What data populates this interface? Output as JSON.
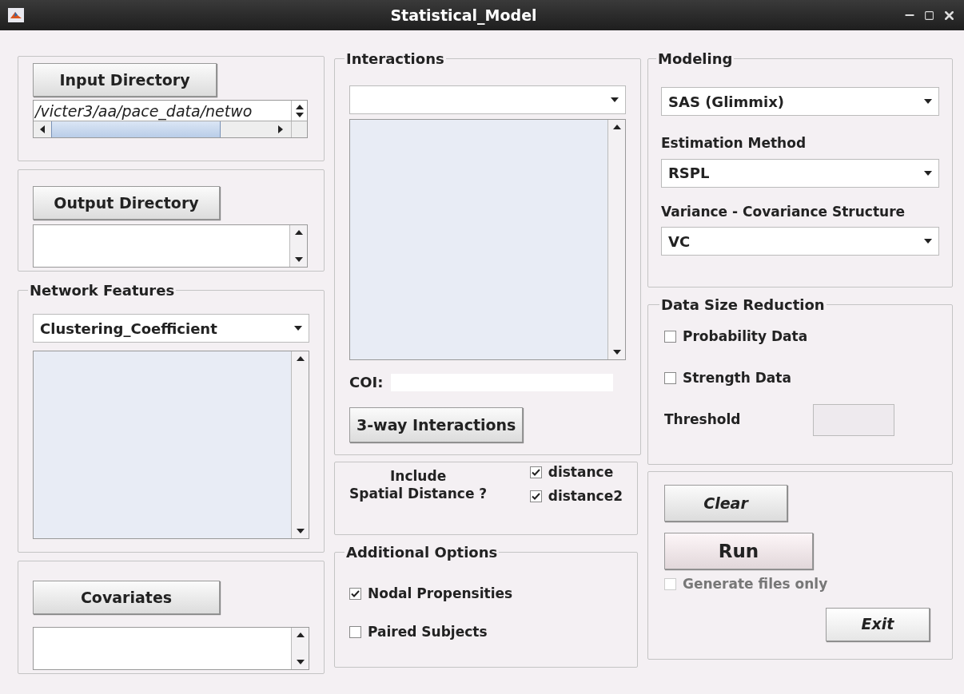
{
  "window": {
    "title": "Statistical_Model"
  },
  "input_directory": {
    "button": "Input Directory",
    "value": "/victer3/aa/pace_data/netwo"
  },
  "output_directory": {
    "button": "Output Directory"
  },
  "network_features": {
    "title": "Network Features",
    "dropdown": "Clustering_Coefficient"
  },
  "covariates": {
    "button": "Covariates"
  },
  "interactions": {
    "title": "Interactions",
    "coi_label": "COI:",
    "button": "3-way Interactions"
  },
  "spatial_distance": {
    "label_lines": [
      "Include",
      "Spatial Distance ?"
    ],
    "options": [
      {
        "label": "distance",
        "checked": true
      },
      {
        "label": "distance2",
        "checked": true
      }
    ]
  },
  "additional_options": {
    "title": "Additional Options",
    "options": [
      {
        "label": "Nodal Propensities",
        "checked": true
      },
      {
        "label": "Paired Subjects",
        "checked": false
      }
    ]
  },
  "modeling": {
    "title": "Modeling",
    "software": "SAS (Glimmix)",
    "estimation_label": "Estimation Method",
    "estimation": "RSPL",
    "covariance_label": "Variance - Covariance Structure",
    "covariance": "VC"
  },
  "data_size_reduction": {
    "title": "Data Size Reduction",
    "options": [
      {
        "label": "Probability Data",
        "checked": false
      },
      {
        "label": "Strength Data",
        "checked": false
      }
    ],
    "threshold_label": "Threshold"
  },
  "actions": {
    "clear": "Clear",
    "run": "Run",
    "generate_files_only": {
      "label": "Generate files only",
      "checked": false,
      "disabled": true
    },
    "exit": "Exit"
  }
}
